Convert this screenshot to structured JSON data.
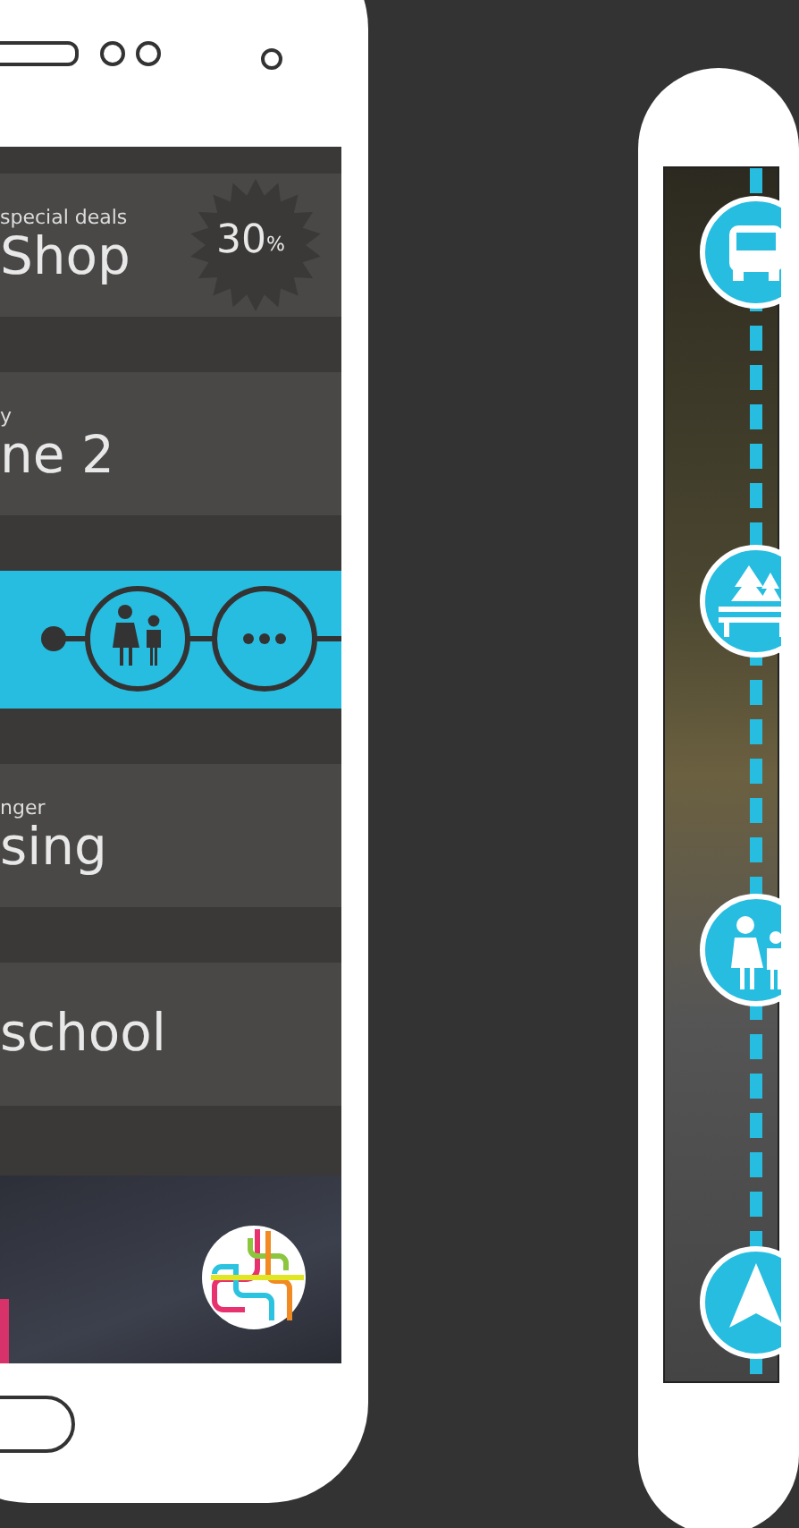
{
  "cards": [
    {
      "kind": "deal",
      "caption": "special deals",
      "title": "Shop",
      "badge": {
        "value": "30",
        "unit": "%"
      }
    },
    {
      "kind": "plain",
      "caption": "y",
      "title": "ne 2"
    },
    {
      "kind": "route"
    },
    {
      "kind": "plain",
      "caption": "nger",
      "title": "sing"
    },
    {
      "kind": "plain",
      "title": "school"
    }
  ]
}
